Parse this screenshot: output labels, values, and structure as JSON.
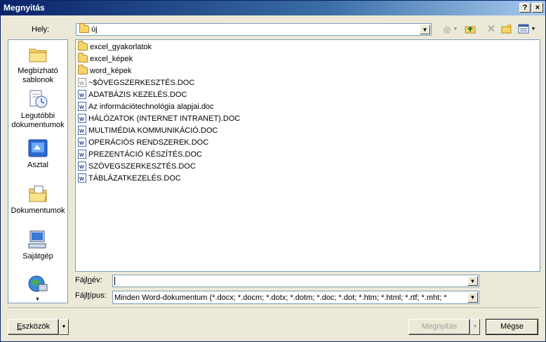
{
  "window": {
    "title": "Megnyitás",
    "help_glyph": "?",
    "close_glyph": "×"
  },
  "lookin": {
    "label": "Hely:",
    "value": "új"
  },
  "places": [
    {
      "label": "Megbízható sablonok",
      "icon": "trusted-templates-icon"
    },
    {
      "label": "Legutóbbi dokumentumok",
      "icon": "recent-documents-icon"
    },
    {
      "label": "Asztal",
      "icon": "desktop-icon"
    },
    {
      "label": "Dokumentumok",
      "icon": "documents-icon"
    },
    {
      "label": "Sajátgép",
      "icon": "my-computer-icon"
    },
    {
      "label": "",
      "icon": "network-icon"
    }
  ],
  "files": [
    {
      "name": "excel_gyakorlatok",
      "type": "folder"
    },
    {
      "name": "excel_képek",
      "type": "folder"
    },
    {
      "name": "word_képek",
      "type": "folder"
    },
    {
      "name": "~$ÖVEGSZERKESZTÉS.DOC",
      "type": "temp"
    },
    {
      "name": "ADATBÁZIS KEZELÉS.DOC",
      "type": "doc"
    },
    {
      "name": "Az információtechnológia alapjai.doc",
      "type": "doc"
    },
    {
      "name": "HÁLÓZATOK (INTERNET INTRANET).DOC",
      "type": "doc"
    },
    {
      "name": "MULTIMÉDIA KOMMUNIKÁCIÓ.DOC",
      "type": "doc"
    },
    {
      "name": "OPERÁCIÓS RENDSZEREK.DOC",
      "type": "doc"
    },
    {
      "name": "PREZENTÁCIÓ KÉSZÍTÉS.DOC",
      "type": "doc"
    },
    {
      "name": "SZÖVEGSZERKESZTÉS.DOC",
      "type": "doc"
    },
    {
      "name": "TÁBLÁZATKEZELÉS.DOC",
      "type": "doc"
    }
  ],
  "filename": {
    "label_pre": "Fájl",
    "label_u": "n",
    "label_post": "év:",
    "value": ""
  },
  "filetype": {
    "label_pre": "Fájl",
    "label_u": "t",
    "label_post": "ípus:",
    "value": "Minden Word-dokumentum (*.docx; *.docm; *.dotx; *.dotm; *.doc; *.dot; *.htm; *.html; *.rtf; *.mht; *"
  },
  "buttons": {
    "tools_u": "E",
    "tools_rest": "szközök",
    "open": "Megnyitás",
    "cancel": "Mégse"
  }
}
